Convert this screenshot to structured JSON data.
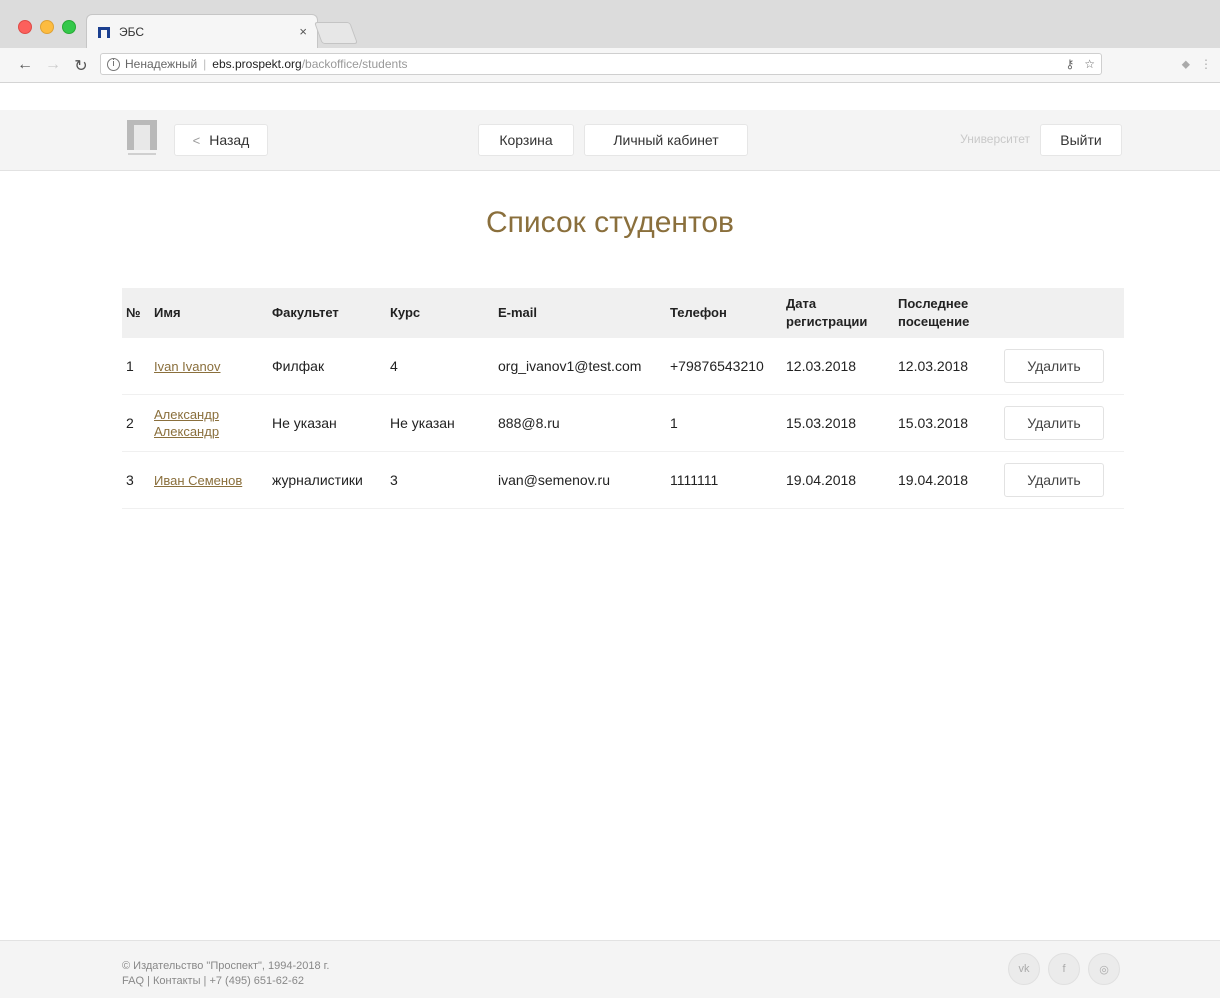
{
  "browser": {
    "tab_title": "ЭБС",
    "tab_close": "×",
    "url_insecure": "Ненадежный",
    "url_host": "ebs.prospekt.org",
    "url_path": "/backoffice/students"
  },
  "header": {
    "back_label": "Назад",
    "cart_label": "Корзина",
    "cabinet_label": "Личный кабинет",
    "university_label": "Университет",
    "logout_label": "Выйти"
  },
  "page": {
    "title": "Список студентов"
  },
  "table": {
    "headers": {
      "num": "№",
      "name": "Имя",
      "faculty": "Факультет",
      "course": "Курс",
      "email": "E-mail",
      "phone": "Телефон",
      "reg_date_1": "Дата",
      "reg_date_2": "регистрации",
      "last_visit_1": "Последнее",
      "last_visit_2": "посещение"
    },
    "delete_label": "Удалить",
    "rows": [
      {
        "num": "1",
        "name_1": "Ivan Ivanov",
        "name_2": "",
        "faculty": "Филфак",
        "course": "4",
        "email": "org_ivanov1@test.com",
        "phone": "+79876543210",
        "reg_date": "12.03.2018",
        "last_visit": "12.03.2018"
      },
      {
        "num": "2",
        "name_1": "Александр",
        "name_2": "Александр",
        "faculty": "Не указан",
        "course": "Не указан",
        "email": "888@8.ru",
        "phone": "1",
        "reg_date": "15.03.2018",
        "last_visit": "15.03.2018"
      },
      {
        "num": "3",
        "name_1": "Иван Семенов",
        "name_2": "",
        "faculty": "журналистики",
        "course": "3",
        "email": "ivan@semenov.ru",
        "phone": "1111111",
        "reg_date": "19.04.2018",
        "last_visit": "19.04.2018"
      }
    ]
  },
  "footer": {
    "copyright": "© Издательство \"Проспект\", 1994-2018 г.",
    "links": "FAQ | Контакты | +7 (495) 651-62-62",
    "social": [
      "vk",
      "f",
      "◎"
    ]
  },
  "colors": {
    "accent": "#8a6f3c",
    "header_bg": "#f4f4f4"
  }
}
